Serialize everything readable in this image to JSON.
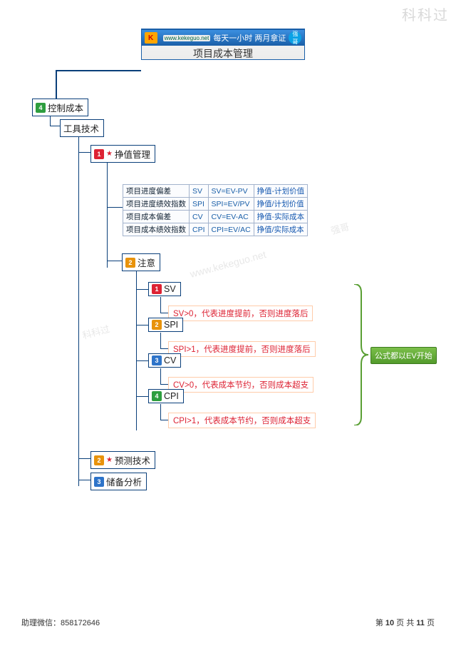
{
  "watermarks": {
    "top_right": "科科过",
    "center": "www.kekeguo.net",
    "kk": "科科过",
    "qg": "强哥"
  },
  "title": {
    "url": "www.kekeguo.net",
    "slogan": "每天一小时    两月拿证",
    "badge": "强 哥",
    "main": "项目成本管理"
  },
  "nodes": {
    "control": "控制成本",
    "tools": "工具技术",
    "evm": "挣值管理",
    "note": "注意",
    "sv": "SV",
    "spi": "SPI",
    "cv": "CV",
    "cpi": "CPI",
    "forecast": "预测技术",
    "reserve": "储备分析"
  },
  "idx": {
    "control": "4",
    "evm": "1",
    "note": "2",
    "sv": "1",
    "spi": "2",
    "cv": "3",
    "cpi": "4",
    "forecast": "2",
    "reserve": "3"
  },
  "table": {
    "rows": [
      {
        "name": "项目进度偏差",
        "sym": "SV",
        "formula": "SV=EV-PV",
        "desc": "挣值-计划价值"
      },
      {
        "name": "项目进度绩效指数",
        "sym": "SPI",
        "formula": "SPI=EV/PV",
        "desc": "挣值/计划价值"
      },
      {
        "name": "项目成本偏差",
        "sym": "CV",
        "formula": "CV=EV-AC",
        "desc": "挣值-实际成本"
      },
      {
        "name": "项目成本绩效指数",
        "sym": "CPI",
        "formula": "CPI=EV/AC",
        "desc": "挣值/实际成本"
      }
    ]
  },
  "rules": {
    "sv": "SV>0，代表进度提前，否则进度落后",
    "spi": "SPI>1，代表进度提前，否则进度落后",
    "cv": "CV>0，代表成本节约，否则成本超支",
    "cpi": "CPI>1，代表成本节约，否则成本超支"
  },
  "side_note": "公式都以EV开始",
  "footer": {
    "left": "助理微信：858172646",
    "right_a": "第 ",
    "right_b": "10",
    "right_c": " 页 共 ",
    "right_d": "11",
    "right_e": " 页"
  }
}
